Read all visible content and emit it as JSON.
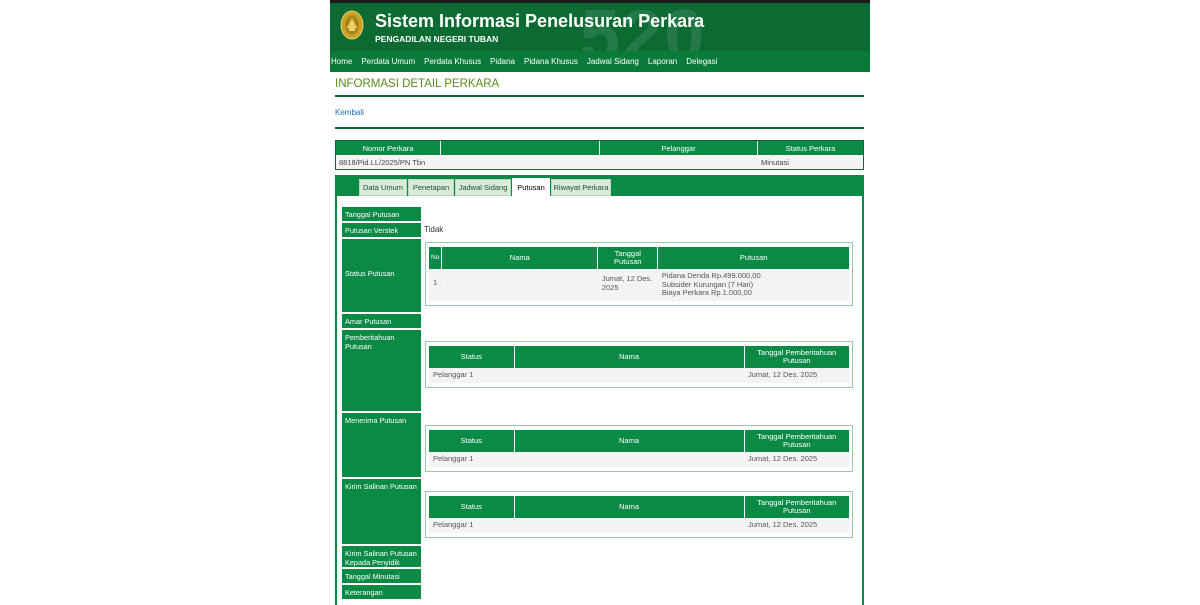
{
  "header": {
    "title": "Sistem Informasi Penelusuran Perkara",
    "subtitle": "PENGADILAN NEGERI TUBAN",
    "watermark": "520"
  },
  "nav": [
    "Home",
    "Perdata Umum",
    "Perdata Khusus",
    "Pidana",
    "Pidana Khusus",
    "Jadwal Sidang",
    "Laporan",
    "Delegasi"
  ],
  "page": {
    "title": "INFORMASI DETAIL PERKARA",
    "back": "Kembali"
  },
  "summary": {
    "headers": [
      "Nomor Perkara",
      "",
      "Pelanggar",
      "Status Perkara"
    ],
    "nomor": "8818/Pid.LL/2025/PN Tbn",
    "status": "Minutasi"
  },
  "tabs": [
    "Data Umum",
    "Penetapan",
    "Jadwal Sidang",
    "Putusan",
    "Riwayat Perkara"
  ],
  "active_tab": "Putusan",
  "labels": {
    "tanggal_putusan": "Tanggal Putusan",
    "putusan_verstek": "Putusan Verstek",
    "status_putusan": "Status Putusan",
    "amar_putusan": "Amar Putusan",
    "pemberitahuan_putusan": "Pemberitahuan Putusan",
    "menerima_putusan": "Menerima Putusan",
    "kirim_salinan": "Kirim Salinan Putusan",
    "kirim_salinan_penyidik": "Kirim Salinan Putusan Kepada Penyidik",
    "tanggal_minutasi": "Tanggal Minutasi",
    "keterangan": "Keterangan"
  },
  "values": {
    "putusan_verstek": "Tidak"
  },
  "status_table": {
    "headers": [
      "No",
      "Nama",
      "Tanggal Putusan",
      "Putusan"
    ],
    "row": {
      "no": "1",
      "nama": "-",
      "tanggal": "Jumat, 12 Des. 2025",
      "putusan": [
        "Pidana Denda Rp.499.000,00",
        "Subsider Kurungan (7 Hari)",
        "Biaya Perkara Rp.1.000,00"
      ]
    }
  },
  "notify_headers": [
    "Status",
    "Nama",
    "Tanggal Pemberitahuan Putusan"
  ],
  "pemberitahuan_row": {
    "status": "Pelanggar 1",
    "nama": "",
    "tanggal": "Jumat, 12 Des. 2025"
  },
  "menerima_row": {
    "status": "Pelanggar 1",
    "nama": "",
    "tanggal": "Jumat, 12 Des. 2025"
  },
  "kirim_row": {
    "status": "Pelanggar 1",
    "nama": "",
    "tanggal": "Jumat, 12 Des. 2025"
  }
}
